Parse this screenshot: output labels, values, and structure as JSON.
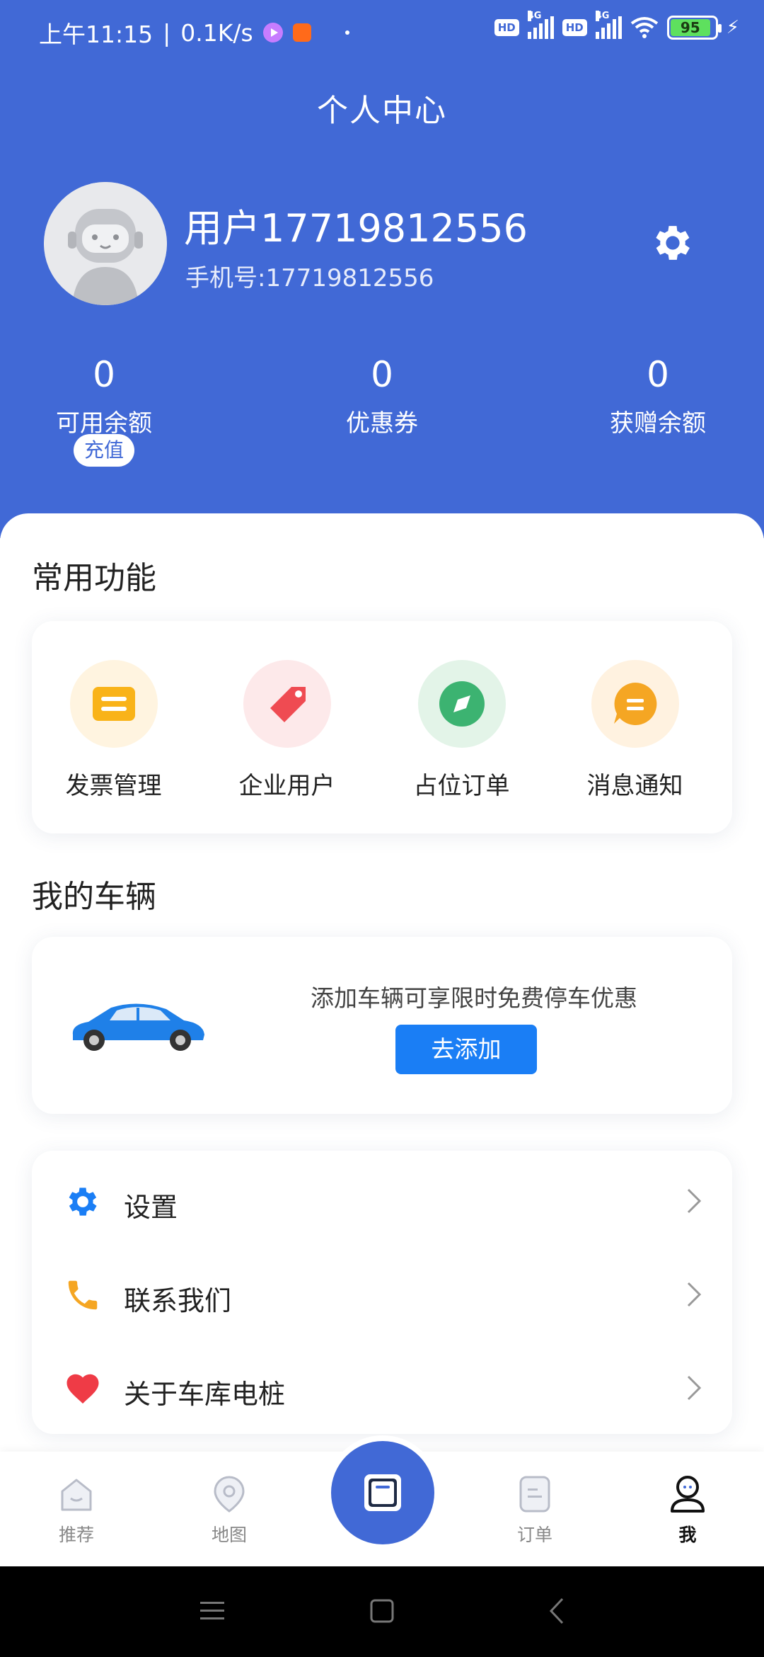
{
  "status_bar": {
    "time": "上午11:15",
    "speed": "0.1K/s",
    "network_label": "4G",
    "hd_label": "HD",
    "battery": "95"
  },
  "page_title": "个人中心",
  "profile": {
    "name": "用户17719812556",
    "phone": "手机号:17719812556"
  },
  "stats": [
    {
      "value": "0",
      "label": "可用余额"
    },
    {
      "value": "0",
      "label": "优惠券"
    },
    {
      "value": "0",
      "label": "获赠余额"
    }
  ],
  "recharge_label": "充值",
  "common_functions": {
    "title": "常用功能",
    "items": [
      {
        "label": "发票管理",
        "icon": "invoice-icon",
        "color": "#f9b319"
      },
      {
        "label": "企业用户",
        "icon": "tag-icon",
        "color": "#ef4b52"
      },
      {
        "label": "占位订单",
        "icon": "compass-icon",
        "color": "#3cb371"
      },
      {
        "label": "消息通知",
        "icon": "message-icon",
        "color": "#f5a623"
      }
    ]
  },
  "vehicles": {
    "title": "我的车辆",
    "promo": "添加车辆可享限时免费停车优惠",
    "add_label": "去添加"
  },
  "menu": [
    {
      "label": "设置",
      "icon": "gear-icon",
      "color": "#1a7ef5"
    },
    {
      "label": "联系我们",
      "icon": "phone-icon",
      "color": "#f5a623"
    },
    {
      "label": "关于车库电桩",
      "icon": "heart-icon",
      "color": "#ef3b46"
    }
  ],
  "bottom_nav": [
    {
      "label": "推荐",
      "icon": "home-icon"
    },
    {
      "label": "地图",
      "icon": "map-pin-icon"
    },
    {
      "label": "",
      "icon": "scan-icon"
    },
    {
      "label": "订单",
      "icon": "order-icon"
    },
    {
      "label": "我",
      "icon": "user-icon",
      "active": true
    }
  ],
  "colors": {
    "primary": "#4169d6",
    "button_blue": "#1a7ef5"
  }
}
